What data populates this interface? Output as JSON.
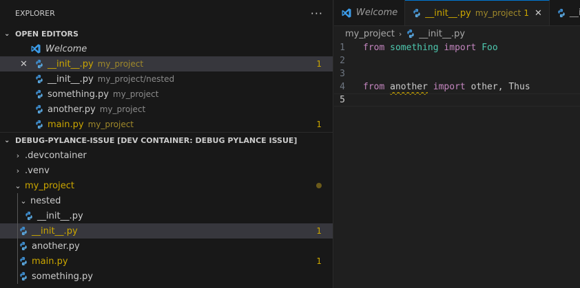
{
  "explorer": {
    "title": "EXPLORER"
  },
  "open_editors": {
    "header": "OPEN EDITORS",
    "items": [
      {
        "name": "Welcome",
        "path": "",
        "badge": ""
      },
      {
        "name": "__init__.py",
        "path": "my_project",
        "badge": "1"
      },
      {
        "name": "__init__.py",
        "path": "my_project/nested",
        "badge": ""
      },
      {
        "name": "something.py",
        "path": "my_project",
        "badge": ""
      },
      {
        "name": "another.py",
        "path": "my_project",
        "badge": ""
      },
      {
        "name": "main.py",
        "path": "my_project",
        "badge": "1"
      }
    ]
  },
  "workspace": {
    "header": "DEBUG-PYLANCE-ISSUE [DEV CONTAINER: DEBUG PYLANCE ISSUE]",
    "items": [
      {
        "name": ".devcontainer",
        "badge": ""
      },
      {
        "name": ".venv",
        "badge": ""
      },
      {
        "name": "my_project",
        "badge": ""
      },
      {
        "name": "nested",
        "badge": ""
      },
      {
        "name": "__init__.py",
        "badge": ""
      },
      {
        "name": "__init__.py",
        "badge": "1"
      },
      {
        "name": "another.py",
        "badge": ""
      },
      {
        "name": "main.py",
        "badge": "1"
      },
      {
        "name": "something.py",
        "badge": ""
      }
    ]
  },
  "tabs": [
    {
      "label": "Welcome",
      "desc": "",
      "badge": ""
    },
    {
      "label": "__init__.py",
      "desc": "my_project",
      "badge": "1"
    },
    {
      "label": "__in",
      "desc": "",
      "badge": ""
    }
  ],
  "breadcrumb": {
    "folder": "my_project",
    "file": "__init__.py"
  },
  "code": {
    "line_numbers": [
      "1",
      "2",
      "3",
      "4",
      "5"
    ],
    "line1": {
      "kw1": "from",
      "mod": "something",
      "kw2": "import",
      "name": "Foo"
    },
    "line4": {
      "kw1": "from",
      "mod": "another",
      "kw2": "import",
      "names": "other, Thus"
    }
  },
  "colors": {
    "accent": "#0078d4",
    "warning": "#cca700",
    "keyword": "#c586c0",
    "module": "#4ec9b0"
  },
  "icons": {
    "python": "python-file-icon",
    "vscode": "vscode-logo-icon"
  }
}
